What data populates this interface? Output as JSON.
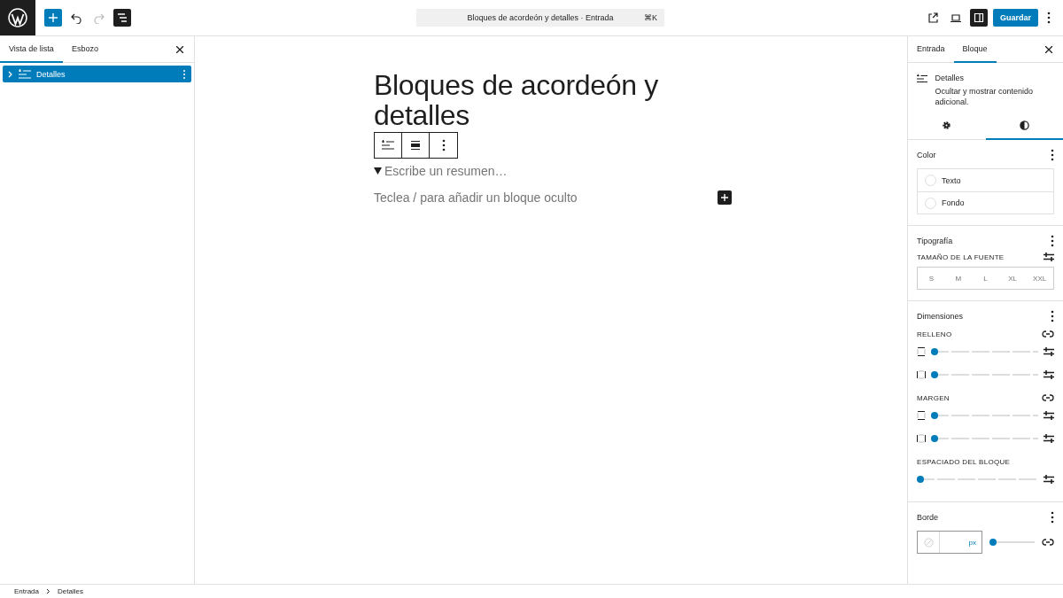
{
  "topbar": {
    "tools": [
      {
        "kind": "add",
        "selected": true,
        "disabled": false
      },
      {
        "kind": "undo",
        "selected": false,
        "disabled": false
      },
      {
        "kind": "redo",
        "selected": false,
        "disabled": true
      },
      {
        "kind": "outline",
        "selected": true,
        "disabled": false
      }
    ],
    "command": {
      "title": "Bloques de acordeón y detalles · Entrada",
      "shortcut": "⌘K"
    },
    "actions": [
      {
        "kind": "external",
        "selected": false,
        "disabled": false
      },
      {
        "kind": "device",
        "selected": false,
        "disabled": false
      },
      {
        "kind": "sidebar",
        "selected": true,
        "disabled": false
      }
    ],
    "save": "Guardar"
  },
  "left_panel": {
    "tabs": [
      {
        "label": "Vista de lista",
        "selected": true
      },
      {
        "label": "Esbozo",
        "selected": false
      }
    ],
    "items": [
      {
        "label": "Detalles",
        "selected": true,
        "expanded": false
      }
    ]
  },
  "editor": {
    "title": "Bloques de acordeón y detalles",
    "summary": "Escribe un resumen…",
    "placeholder": "Teclea / para añadir un bloque oculto"
  },
  "right_panel": {
    "tabs": [
      {
        "label": "Entrada",
        "selected": false
      },
      {
        "label": "Bloque",
        "selected": true
      }
    ],
    "block": {
      "name": "Detalles",
      "description": "Ocultar y mostrar contenido adicional."
    },
    "icon_tabs": [
      {
        "kind": "settings",
        "selected": false
      },
      {
        "kind": "styles",
        "selected": true
      }
    ],
    "color": {
      "title": "Color",
      "items": [
        {
          "label": "Texto"
        },
        {
          "label": "Fondo"
        }
      ]
    },
    "typography": {
      "title": "Tipografía",
      "label": "TAMAÑO DE LA FUENTE",
      "sizes": [
        {
          "label": "S",
          "selected": false
        },
        {
          "label": "M",
          "selected": false
        },
        {
          "label": "L",
          "selected": false
        },
        {
          "label": "XL",
          "selected": false
        },
        {
          "label": "XXL",
          "selected": false
        }
      ]
    },
    "dimensions": {
      "title": "Dimensiones",
      "groups": [
        {
          "label": "RELLENO",
          "kind": "sides",
          "sliders": [
            {
              "kind": "vertical",
              "level": 0
            },
            {
              "kind": "horizontal",
              "level": 0
            }
          ]
        },
        {
          "label": "MARGEN",
          "kind": "sides",
          "sliders": [
            {
              "kind": "vertical",
              "level": 0
            },
            {
              "kind": "horizontal",
              "level": 0
            }
          ]
        },
        {
          "label": "ESPACIADO DEL BLOQUE",
          "kind": "single",
          "sliders": [
            {
              "kind": "none",
              "level": 0
            }
          ]
        }
      ]
    },
    "border": {
      "title": "Borde",
      "unit": "px",
      "level": 0
    }
  },
  "breadcrumb": [
    "Entrada",
    "Detalles"
  ]
}
